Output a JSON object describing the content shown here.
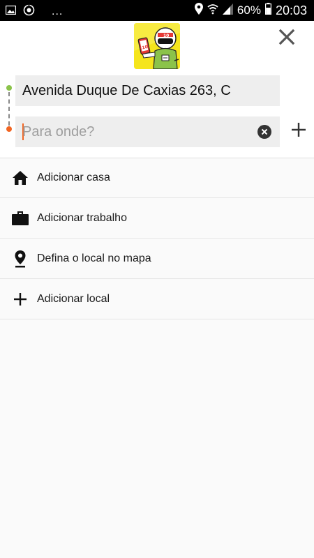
{
  "status_bar": {
    "overflow": "...",
    "battery": "60%",
    "time": "20:03"
  },
  "search": {
    "origin_value": "Avenida Duque De Caxias 263, C",
    "destination_placeholder": "Para onde?"
  },
  "shortcuts": [
    {
      "label": "Adicionar casa",
      "icon": "home-icon"
    },
    {
      "label": "Adicionar trabalho",
      "icon": "briefcase-icon"
    },
    {
      "label": "Defina o local no mapa",
      "icon": "location-pin-icon"
    },
    {
      "label": "Adicionar local",
      "icon": "plus-icon"
    }
  ],
  "colors": {
    "brand_yellow": "#f5e51c",
    "origin_dot": "#8bc34a",
    "destination_dot": "#f26522"
  }
}
